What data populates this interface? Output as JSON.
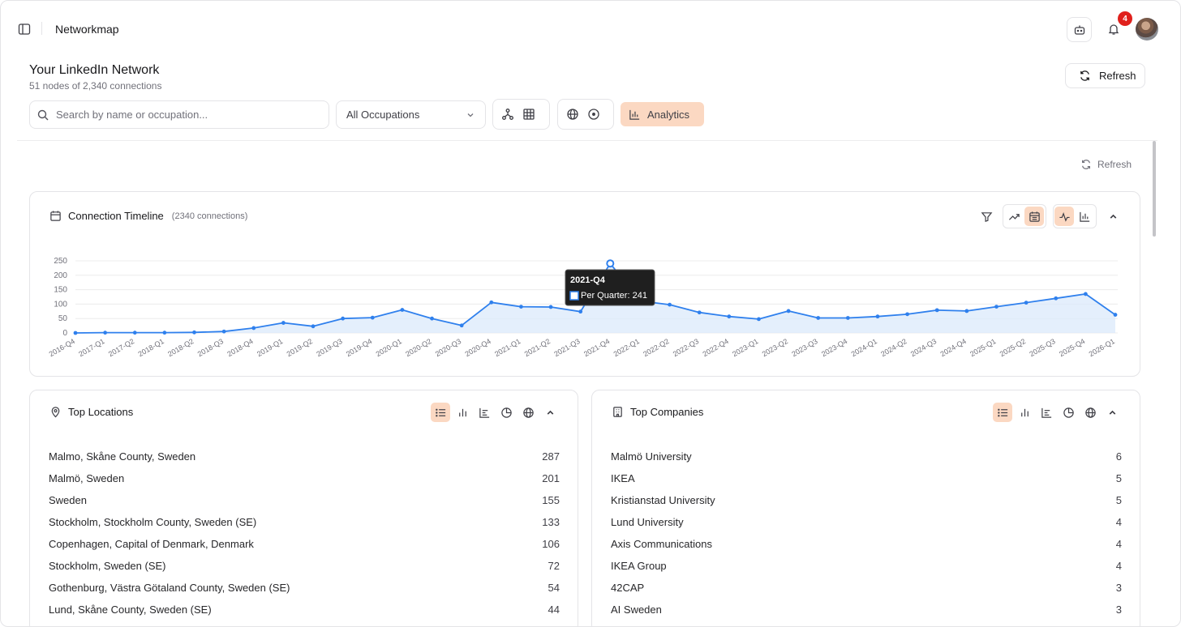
{
  "app": {
    "title": "Networkmap",
    "notification_count": "4"
  },
  "header": {
    "title": "Your LinkedIn Network",
    "subtitle": "51 nodes of 2,340 connections",
    "refresh_label": "Refresh"
  },
  "toolbar": {
    "search_placeholder": "Search by name or occupation...",
    "occupation_select": "All Occupations",
    "analytics_label": "Analytics"
  },
  "analytics_refresh_label": "Refresh",
  "timeline": {
    "title": "Connection Timeline",
    "count_label": "(2340 connections)",
    "tooltip": {
      "title": "2021-Q4",
      "label": "Per Quarter: 241"
    }
  },
  "chart_data": {
    "type": "area",
    "title": "Connection Timeline",
    "series": [
      {
        "name": "Per Quarter",
        "values": [
          0,
          1,
          1,
          1,
          2,
          5,
          17,
          35,
          23,
          50,
          53,
          80,
          50,
          26,
          106,
          91,
          90,
          74,
          241,
          111,
          98,
          71,
          57,
          48,
          76,
          52,
          52,
          57,
          65,
          79,
          76,
          91,
          105,
          120,
          135,
          63
        ]
      }
    ],
    "x": [
      "2016-Q4",
      "2017-Q1",
      "2017-Q2",
      "2018-Q1",
      "2018-Q2",
      "2018-Q3",
      "2018-Q4",
      "2019-Q1",
      "2019-Q2",
      "2019-Q3",
      "2019-Q4",
      "2020-Q1",
      "2020-Q2",
      "2020-Q3",
      "2020-Q4",
      "2021-Q1",
      "2021-Q2",
      "2021-Q3",
      "2021-Q4",
      "2022-Q1",
      "2022-Q2",
      "2022-Q3",
      "2022-Q4",
      "2023-Q1",
      "2023-Q2",
      "2023-Q3",
      "2023-Q4",
      "2024-Q1",
      "2024-Q2",
      "2024-Q3",
      "2024-Q4",
      "2025-Q1",
      "2025-Q2",
      "2025-Q3",
      "2025-Q4",
      "2026-Q1"
    ],
    "yticks": [
      "0",
      "50",
      "100",
      "150",
      "200",
      "250"
    ],
    "ylim": [
      0,
      250
    ],
    "grid": true,
    "colors": {
      "line": "#2f80ed",
      "fill": "#dbe9fb"
    }
  },
  "locations": {
    "title": "Top Locations",
    "items": [
      {
        "name": "Malmo, Skåne County, Sweden",
        "count": "287"
      },
      {
        "name": "Malmö, Sweden",
        "count": "201"
      },
      {
        "name": "Sweden",
        "count": "155"
      },
      {
        "name": "Stockholm, Stockholm County, Sweden (SE)",
        "count": "133"
      },
      {
        "name": "Copenhagen, Capital of Denmark, Denmark",
        "count": "106"
      },
      {
        "name": "Stockholm, Sweden (SE)",
        "count": "72"
      },
      {
        "name": "Gothenburg, Västra Götaland County, Sweden (SE)",
        "count": "54"
      },
      {
        "name": "Lund, Skåne County, Sweden (SE)",
        "count": "44"
      }
    ]
  },
  "companies": {
    "title": "Top Companies",
    "items": [
      {
        "name": "Malmö University",
        "count": "6"
      },
      {
        "name": "IKEA",
        "count": "5"
      },
      {
        "name": "Kristianstad University",
        "count": "5"
      },
      {
        "name": "Lund University",
        "count": "4"
      },
      {
        "name": "Axis Communications",
        "count": "4"
      },
      {
        "name": "IKEA Group",
        "count": "4"
      },
      {
        "name": "42CAP",
        "count": "3"
      },
      {
        "name": "AI Sweden",
        "count": "3"
      }
    ]
  },
  "colors": {
    "accent": "#fbd8c2",
    "badge": "#e0201c",
    "line": "#2f80ed"
  }
}
